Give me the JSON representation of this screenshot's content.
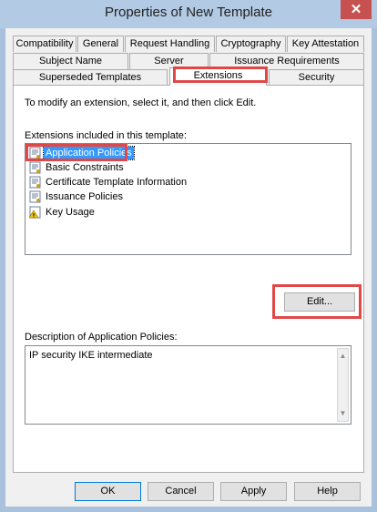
{
  "window": {
    "title": "Properties of New Template",
    "close_glyph": "✕"
  },
  "tabs_row1": [
    "Compatibility",
    "General",
    "Request Handling",
    "Cryptography",
    "Key Attestation"
  ],
  "tabs_row2": [
    "Subject Name",
    "Server",
    "Issuance Requirements"
  ],
  "tabs_row3": [
    "Superseded Templates",
    "Extensions",
    "Security"
  ],
  "active_tab": "Extensions",
  "panel": {
    "instruction": "To modify an extension, select it, and then click Edit.",
    "extensions_label": "Extensions included in this template:",
    "extensions": [
      {
        "label": "Application Policies",
        "icon": "certificate-icon",
        "selected": true
      },
      {
        "label": "Basic Constraints",
        "icon": "certificate-icon"
      },
      {
        "label": "Certificate Template Information",
        "icon": "certificate-icon"
      },
      {
        "label": "Issuance Policies",
        "icon": "certificate-icon"
      },
      {
        "label": "Key Usage",
        "icon": "warning-certificate-icon"
      }
    ],
    "edit_button": "Edit...",
    "description_label": "Description of Application Policies:",
    "description_text": "IP security IKE intermediate"
  },
  "buttons": {
    "ok": "OK",
    "cancel": "Cancel",
    "apply": "Apply",
    "help": "Help"
  },
  "colors": {
    "selection": "#3399ff",
    "highlight": "#e04848",
    "titlebar": "#b2cae3"
  }
}
